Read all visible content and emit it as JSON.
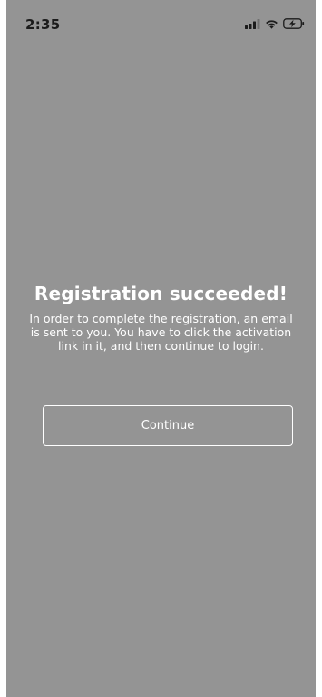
{
  "status_bar": {
    "time": "2:35",
    "icons": [
      "signal-icon",
      "wifi-icon",
      "battery-charging-icon"
    ]
  },
  "dialog": {
    "title": "Registration succeeded!",
    "message": "In order to complete the registration, an email is sent to you. You have to click the activation link in it, and then continue to login.",
    "continue_label": "Continue"
  },
  "colors": {
    "background": "#949494",
    "text": "#ffffff",
    "status_text": "#1b1b1b"
  }
}
